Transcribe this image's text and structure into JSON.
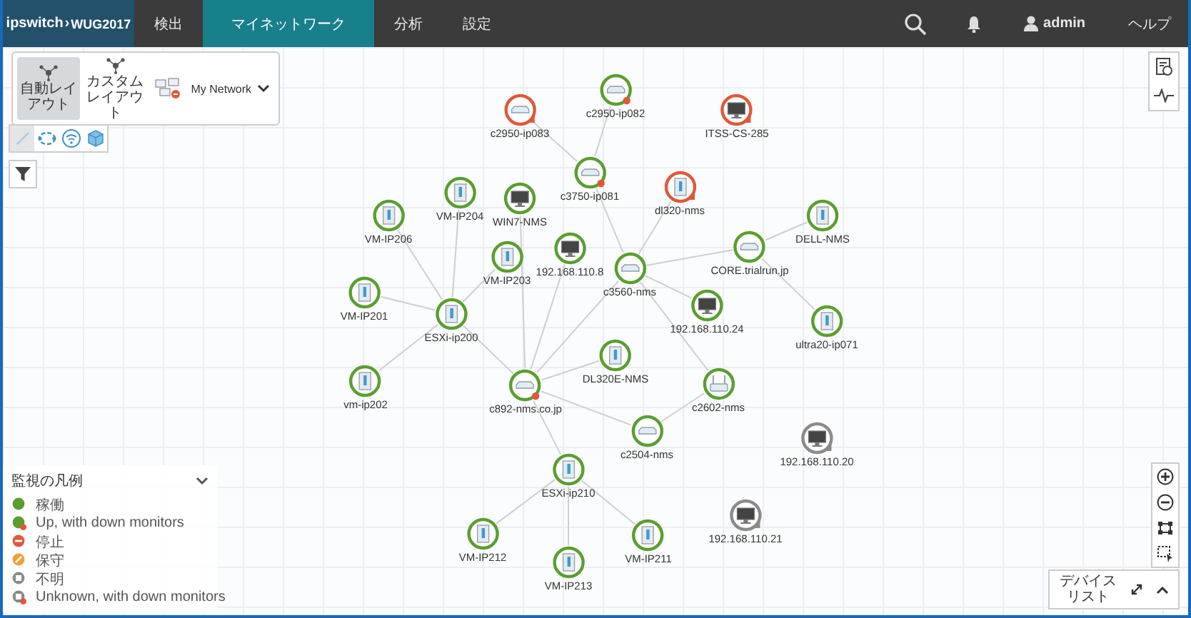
{
  "header": {
    "logo": "ipswitch",
    "separator": "›",
    "product": "WUG2017",
    "user": "admin",
    "help": "ヘルプ",
    "nav": [
      {
        "label": "検出",
        "selected": false
      },
      {
        "label": "マイネットワーク",
        "selected": true
      },
      {
        "label": "分析",
        "selected": false
      },
      {
        "label": "設定",
        "selected": false
      }
    ]
  },
  "layout_panel": {
    "buttons": [
      {
        "label": "自動レイアウト",
        "selected": true
      },
      {
        "label": "カスタムレイアウト",
        "selected": false
      }
    ],
    "network": "My Network"
  },
  "view_tools": [
    {
      "kind": "links",
      "selected": true
    },
    {
      "kind": "ring",
      "selected": false
    },
    {
      "kind": "wireless",
      "selected": false
    },
    {
      "kind": "cube",
      "selected": false
    }
  ],
  "nodes": [
    {
      "label": "c2950-ip083",
      "kind": "switch",
      "color": "#e0583a",
      "alert": true,
      "down_monitors": false
    },
    {
      "label": "c2950-ip082",
      "kind": "switch",
      "color": "#5a9e2f",
      "alert": false,
      "down_monitors": true
    },
    {
      "label": "ITSS-CS-285",
      "kind": "monitor",
      "color": "#e0583a",
      "alert": true,
      "down_monitors": false
    },
    {
      "label": "c3750-ip081",
      "kind": "switch",
      "color": "#5a9e2f",
      "alert": false,
      "down_monitors": true
    },
    {
      "label": "dl320-nms",
      "kind": "server",
      "color": "#e0583a",
      "alert": true,
      "down_monitors": false
    },
    {
      "label": "VM-IP206",
      "kind": "server",
      "color": "#5a9e2f",
      "alert": false,
      "down_monitors": false
    },
    {
      "label": "VM-IP204",
      "kind": "server",
      "color": "#5a9e2f",
      "alert": false,
      "down_monitors": false
    },
    {
      "label": "WIN7-NMS",
      "kind": "monitor",
      "color": "#5a9e2f",
      "alert": false,
      "down_monitors": false
    },
    {
      "label": "DELL-NMS",
      "kind": "server",
      "color": "#5a9e2f",
      "alert": false,
      "down_monitors": false
    },
    {
      "label": "CORE.trialrun.jp",
      "kind": "switch",
      "color": "#5a9e2f",
      "alert": false,
      "down_monitors": false
    },
    {
      "label": "VM-IP203",
      "kind": "server",
      "color": "#5a9e2f",
      "alert": false,
      "down_monitors": false
    },
    {
      "label": "192.168.110.8",
      "kind": "monitor",
      "color": "#5a9e2f",
      "alert": false,
      "down_monitors": false
    },
    {
      "label": "c3560-nms",
      "kind": "switch",
      "color": "#5a9e2f",
      "alert": false,
      "down_monitors": false
    },
    {
      "label": "VM-IP201",
      "kind": "server",
      "color": "#5a9e2f",
      "alert": false,
      "down_monitors": false
    },
    {
      "label": "ESXi-ip200",
      "kind": "server",
      "color": "#5a9e2f",
      "alert": false,
      "down_monitors": false
    },
    {
      "label": "192.168.110.24",
      "kind": "monitor",
      "color": "#5a9e2f",
      "alert": false,
      "down_monitors": false
    },
    {
      "label": "ultra20-ip071",
      "kind": "server",
      "color": "#5a9e2f",
      "alert": false,
      "down_monitors": false
    },
    {
      "label": "vm-ip202",
      "kind": "server",
      "color": "#5a9e2f",
      "alert": false,
      "down_monitors": false
    },
    {
      "label": "c892-nms.co.jp",
      "kind": "switch",
      "color": "#5a9e2f",
      "alert": false,
      "down_monitors": true
    },
    {
      "label": "DL320E-NMS",
      "kind": "server",
      "color": "#5a9e2f",
      "alert": false,
      "down_monitors": false
    },
    {
      "label": "c2602-nms",
      "kind": "router",
      "color": "#5a9e2f",
      "alert": false,
      "down_monitors": false
    },
    {
      "label": "c2504-nms",
      "kind": "switch",
      "color": "#5a9e2f",
      "alert": false,
      "down_monitors": false
    },
    {
      "label": "192.168.110.20",
      "kind": "monitor",
      "color": "#8a8a8a",
      "alert": true,
      "down_monitors": false
    },
    {
      "label": "ESXi-ip210",
      "kind": "server",
      "color": "#5a9e2f",
      "alert": false,
      "down_monitors": false
    },
    {
      "label": "192.168.110.21",
      "kind": "monitor",
      "color": "#8a8a8a",
      "alert": true,
      "down_monitors": false
    },
    {
      "label": "VM-IP212",
      "kind": "server",
      "color": "#5a9e2f",
      "alert": false,
      "down_monitors": false
    },
    {
      "label": "VM-IP213",
      "kind": "server",
      "color": "#5a9e2f",
      "alert": false,
      "down_monitors": false
    },
    {
      "label": "VM-IP211",
      "kind": "server",
      "color": "#5a9e2f",
      "alert": false,
      "down_monitors": false
    }
  ],
  "legend": {
    "title": "監視の凡例",
    "items": [
      {
        "label": "稼働",
        "kind": "up",
        "down_monitors": false
      },
      {
        "label": "Up, with down monitors",
        "kind": "up",
        "down_monitors": true
      },
      {
        "label": "停止",
        "kind": "down",
        "down_monitors": false
      },
      {
        "label": "保守",
        "kind": "maintenance",
        "down_monitors": false
      },
      {
        "label": "不明",
        "kind": "unknown",
        "down_monitors": false
      },
      {
        "label": "Unknown, with down monitors",
        "kind": "unknown",
        "down_monitors": true
      }
    ]
  },
  "device_list": {
    "label": "デバイスリスト"
  }
}
